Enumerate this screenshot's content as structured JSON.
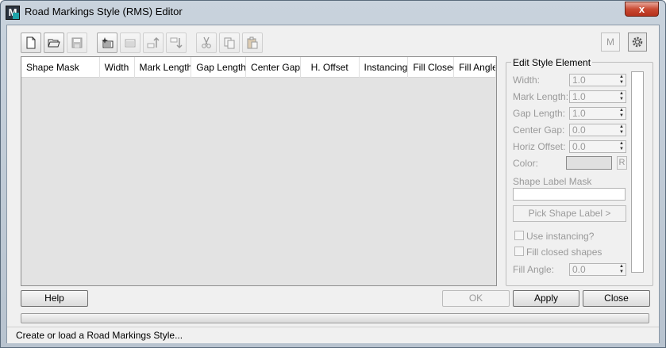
{
  "window": {
    "title": "Road Markings Style (RMS) Editor",
    "app_icon_letter": "M",
    "close_symbol": "x"
  },
  "toolbar": {
    "buttons": [
      {
        "icon": "new-file-icon",
        "enabled": true
      },
      {
        "icon": "open-folder-icon",
        "enabled": true
      },
      {
        "icon": "save-disk-icon",
        "enabled": false
      },
      {
        "icon": "add-element-icon",
        "enabled": true
      },
      {
        "icon": "remove-element-icon",
        "enabled": false
      },
      {
        "icon": "move-up-icon",
        "enabled": false
      },
      {
        "icon": "move-down-icon",
        "enabled": false
      },
      {
        "icon": "cut-icon",
        "enabled": false
      },
      {
        "icon": "copy-icon",
        "enabled": false
      },
      {
        "icon": "paste-icon",
        "enabled": false
      }
    ],
    "m_label": "M",
    "settings_icon": "gear-icon"
  },
  "table": {
    "columns": [
      "Shape Mask",
      "Width",
      "Mark Length",
      "Gap Length",
      "Center Gap",
      "H. Offset",
      "Instancing",
      "Fill Closed",
      "Fill Angle"
    ],
    "rows": []
  },
  "edit_group": {
    "title": "Edit Style Element",
    "width_label": "Width:",
    "width_value": "1.0",
    "mark_length_label": "Mark Length:",
    "mark_length_value": "1.0",
    "gap_length_label": "Gap Length:",
    "gap_length_value": "1.0",
    "center_gap_label": "Center Gap:",
    "center_gap_value": "0.0",
    "horiz_offset_label": "Horiz Offset:",
    "horiz_offset_value": "0.0",
    "color_label": "Color:",
    "color_value": "#e0e0e0",
    "r_label": "R",
    "shape_label_mask_label": "Shape Label Mask",
    "shape_label_mask_value": "",
    "pick_shape_label": "Pick Shape Label  >",
    "use_instancing_label": "Use instancing?",
    "fill_closed_label": "Fill closed shapes",
    "fill_angle_label": "Fill Angle:",
    "fill_angle_value": "0.0"
  },
  "buttons": {
    "help": "Help",
    "ok": "OK",
    "apply": "Apply",
    "close": "Close"
  },
  "status": {
    "text": "Create or load a Road Markings Style..."
  }
}
